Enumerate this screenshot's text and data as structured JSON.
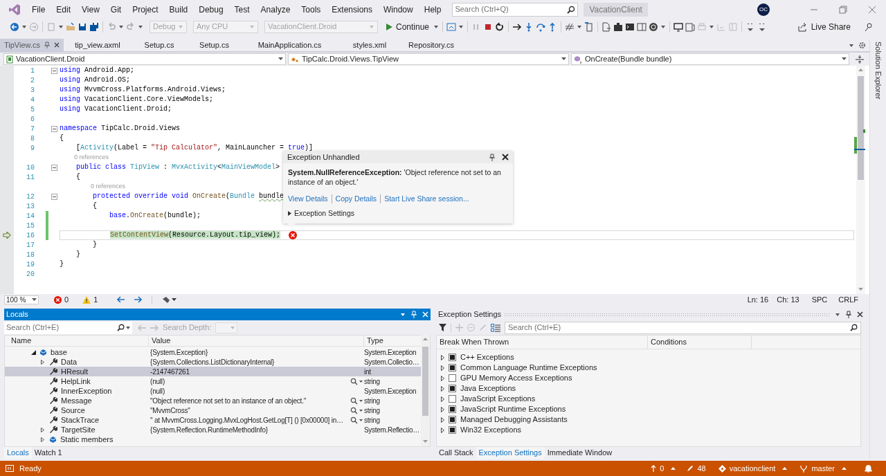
{
  "menu_bar": {
    "menus": [
      "File",
      "Edit",
      "View",
      "Git",
      "Project",
      "Build",
      "Debug",
      "Test",
      "Analyze",
      "Tools",
      "Extensions",
      "Window",
      "Help"
    ],
    "search": {
      "placeholder": "Search (Ctrl+Q)"
    },
    "solution": "VacationClient",
    "avatar": "OC"
  },
  "toolbar": {
    "configuration": {
      "value": "Debug",
      "disabled": true
    },
    "platform": {
      "value": "Any CPU",
      "disabled": true
    },
    "startup_project": {
      "value": "VacationClient.Droid",
      "disabled": true
    },
    "continue": "Continue",
    "live_share": "Live Share"
  },
  "doc_tabs": [
    {
      "label": "TipView.cs",
      "selected": true
    },
    {
      "label": "tip_view.axml",
      "selected": false
    },
    {
      "label": "Setup.cs",
      "selected": false
    },
    {
      "label": "Setup.cs",
      "selected": false
    },
    {
      "label": "MainApplication.cs",
      "selected": false
    },
    {
      "label": "styles.xml",
      "selected": false
    },
    {
      "label": "Repository.cs",
      "selected": false
    }
  ],
  "nav_bar": {
    "project": "VacationClient.Droid",
    "type": "TipCalc.Droid.Views.TipView",
    "member": "OnCreate(Bundle bundle)"
  },
  "editor": {
    "lines": [
      {
        "kind": "code",
        "number": "1",
        "foldable": true,
        "changed": false,
        "current": false,
        "tokens": [
          {
            "kind": "keyword",
            "text": "using"
          },
          {
            "kind": "plain",
            "text": " Android.App;"
          }
        ]
      },
      {
        "kind": "code",
        "number": "2",
        "foldable": false,
        "changed": false,
        "current": false,
        "tokens": [
          {
            "kind": "keyword",
            "text": "using"
          },
          {
            "kind": "plain",
            "text": " Android.OS;"
          }
        ]
      },
      {
        "kind": "code",
        "number": "3",
        "foldable": false,
        "changed": false,
        "current": false,
        "tokens": [
          {
            "kind": "keyword",
            "text": "using"
          },
          {
            "kind": "plain",
            "text": " MvvmCross.Platforms.Android.Views;"
          }
        ]
      },
      {
        "kind": "code",
        "number": "4",
        "foldable": false,
        "changed": false,
        "current": false,
        "tokens": [
          {
            "kind": "keyword",
            "text": "using"
          },
          {
            "kind": "plain",
            "text": " VacationClient.Core.ViewModels;"
          }
        ]
      },
      {
        "kind": "code",
        "number": "5",
        "foldable": false,
        "changed": false,
        "current": false,
        "tokens": [
          {
            "kind": "keyword",
            "text": "using"
          },
          {
            "kind": "plain",
            "text": " VacationClient.Droid;"
          }
        ]
      },
      {
        "kind": "code",
        "number": "6",
        "foldable": false,
        "changed": false,
        "current": false
      },
      {
        "kind": "code",
        "number": "7",
        "foldable": true,
        "changed": false,
        "current": false,
        "tokens": [
          {
            "kind": "keyword",
            "text": "namespace"
          },
          {
            "kind": "plain",
            "text": " TipCalc.Droid.Views"
          }
        ]
      },
      {
        "kind": "code",
        "number": "8",
        "foldable": false,
        "changed": false,
        "current": false,
        "tokens": [
          {
            "kind": "plain",
            "text": "{"
          }
        ]
      },
      {
        "kind": "code",
        "number": "9",
        "foldable": false,
        "changed": false,
        "current": false,
        "tokens": [
          {
            "kind": "plain",
            "text": "    ["
          },
          {
            "kind": "type",
            "text": "Activity"
          },
          {
            "kind": "plain",
            "text": "(Label = "
          },
          {
            "kind": "string",
            "text": "\"Tip Calculator\""
          },
          {
            "kind": "plain",
            "text": ", MainLauncher = "
          },
          {
            "kind": "keyword",
            "text": "true"
          },
          {
            "kind": "plain",
            "text": ")]"
          }
        ]
      },
      {
        "kind": "lens",
        "text": "0 references"
      },
      {
        "kind": "code",
        "number": "10",
        "foldable": true,
        "changed": false,
        "current": false,
        "tokens": [
          {
            "kind": "keyword",
            "text": "    public class "
          },
          {
            "kind": "type",
            "text": "TipView"
          },
          {
            "kind": "plain",
            "text": " : "
          },
          {
            "kind": "type",
            "text": "MvxActivity"
          },
          {
            "kind": "plain",
            "text": "<"
          },
          {
            "kind": "type",
            "text": "MainViewModel"
          },
          {
            "kind": "plain",
            "text": ">"
          }
        ]
      },
      {
        "kind": "code",
        "number": "11",
        "foldable": false,
        "changed": false,
        "current": false,
        "tokens": [
          {
            "kind": "plain",
            "text": "    {"
          }
        ]
      },
      {
        "kind": "lens",
        "text": "0 references"
      },
      {
        "kind": "code",
        "number": "12",
        "foldable": true,
        "changed": false,
        "current": false,
        "tokens": [
          {
            "kind": "keyword",
            "text": "        protected override void "
          },
          {
            "kind": "method",
            "text": "OnCreate"
          },
          {
            "kind": "plain",
            "text": "("
          },
          {
            "kind": "type",
            "text": "Bundle "
          },
          {
            "kind": "warning",
            "text": "bundle"
          }
        ]
      },
      {
        "kind": "code",
        "number": "13",
        "foldable": false,
        "changed": false,
        "current": false,
        "tokens": [
          {
            "kind": "plain",
            "text": "        {"
          }
        ]
      },
      {
        "kind": "code",
        "number": "14",
        "foldable": false,
        "changed": true,
        "current": false,
        "tokens": [
          {
            "kind": "keyword",
            "text": "            base"
          },
          {
            "kind": "plain",
            "text": "."
          },
          {
            "kind": "method",
            "text": "OnCreate"
          },
          {
            "kind": "plain",
            "text": "(bundle);"
          }
        ]
      },
      {
        "kind": "code",
        "number": "15",
        "foldable": false,
        "changed": true,
        "current": false
      },
      {
        "kind": "code",
        "number": "16",
        "foldable": false,
        "changed": true,
        "current": true,
        "tokens": [
          {
            "kind": "method",
            "text": "            SetContentView"
          },
          {
            "kind": "plain",
            "text": "(Resource.Layout.tip_view);"
          }
        ]
      },
      {
        "kind": "code",
        "number": "17",
        "foldable": false,
        "changed": false,
        "current": false,
        "tokens": [
          {
            "kind": "plain",
            "text": "        }"
          }
        ]
      },
      {
        "kind": "code",
        "number": "18",
        "foldable": false,
        "changed": false,
        "current": false,
        "tokens": [
          {
            "kind": "plain",
            "text": "    }"
          }
        ]
      },
      {
        "kind": "code",
        "number": "19",
        "foldable": false,
        "changed": false,
        "current": false,
        "tokens": [
          {
            "kind": "plain",
            "text": "}"
          }
        ]
      },
      {
        "kind": "code",
        "number": "20",
        "foldable": false,
        "changed": false,
        "current": false
      }
    ]
  },
  "exception_popup": {
    "title": "Exception Unhandled",
    "message": "**System.NullReferenceException:** 'Object reference not set to an instance of an object.'",
    "links": [
      "View Details",
      "Copy Details",
      "Start Live Share session..."
    ],
    "settings": "Exception Settings"
  },
  "editor_status": {
    "zoom": "100 %",
    "errors": "0",
    "warnings": "1",
    "line": "Ln: 16",
    "column": "Ch: 13",
    "indent": "SPC",
    "line_ending": "CRLF"
  },
  "locals": {
    "title": "Locals",
    "search": {
      "placeholder": "Search (Ctrl+E)"
    },
    "search_depth": "Search Depth:",
    "columns": [
      "Name",
      "Value",
      "Type"
    ],
    "rows": [
      {
        "name": "base",
        "value": "{System.Exception}",
        "type": "System.Exception",
        "kind": "object",
        "expandable": true,
        "expanded": true,
        "selected": false,
        "visualizer": false,
        "children": [
          {
            "name": "Data",
            "value": "{System.Collections.ListDictionaryInternal}",
            "type": "System.Collectio…",
            "kind": "property",
            "expandable": true,
            "expanded": false,
            "selected": false,
            "visualizer": false
          },
          {
            "name": "HResult",
            "value": "-2147467261",
            "type": "int",
            "kind": "property",
            "expandable": false,
            "expanded": false,
            "selected": true,
            "visualizer": false
          },
          {
            "name": "HelpLink",
            "value": "(null)",
            "type": "string",
            "kind": "property",
            "expandable": false,
            "expanded": false,
            "selected": false,
            "visualizer": true
          },
          {
            "name": "InnerException",
            "value": "(null)",
            "type": "System.Exception",
            "kind": "property",
            "expandable": false,
            "expanded": false,
            "selected": false,
            "visualizer": false
          },
          {
            "name": "Message",
            "value": "\"Object reference not set to an instance of an object.\"",
            "type": "string",
            "kind": "property",
            "expandable": false,
            "expanded": false,
            "selected": false,
            "visualizer": true
          },
          {
            "name": "Source",
            "value": "\"MvvmCross\"",
            "type": "string",
            "kind": "property",
            "expandable": false,
            "expanded": false,
            "selected": false,
            "visualizer": true
          },
          {
            "name": "StackTrace",
            "value": "\"  at MvvmCross.Logging.MvxLogHost.GetLog[T] () [0x00000] in…",
            "type": "string",
            "kind": "property",
            "expandable": false,
            "expanded": false,
            "selected": false,
            "visualizer": true
          },
          {
            "name": "TargetSite",
            "value": "{System.Reflection.RuntimeMethodInfo}",
            "type": "System.Reflectio…",
            "kind": "property",
            "expandable": true,
            "expanded": false,
            "selected": false,
            "visualizer": false
          },
          {
            "name": "Static members",
            "kind": "object",
            "expandable": true,
            "expanded": false,
            "selected": false,
            "visualizer": false
          }
        ]
      }
    ],
    "tabs": [
      {
        "label": "Locals",
        "selected": true
      },
      {
        "label": "Watch 1",
        "selected": false
      }
    ]
  },
  "exception_settings": {
    "title": "Exception Settings",
    "search": {
      "placeholder": "Search (Ctrl+E)"
    },
    "columns": [
      "Break When Thrown",
      "Conditions"
    ],
    "rows": [
      {
        "label": "C++ Exceptions",
        "checked": true
      },
      {
        "label": "Common Language Runtime Exceptions",
        "checked": true
      },
      {
        "label": "GPU Memory Access Exceptions",
        "checked": false
      },
      {
        "label": "Java Exceptions",
        "checked": true
      },
      {
        "label": "JavaScript Exceptions",
        "checked": false
      },
      {
        "label": "JavaScript Runtime Exceptions",
        "checked": true
      },
      {
        "label": "Managed Debugging Assistants",
        "checked": true
      },
      {
        "label": "Win32 Exceptions",
        "checked": true
      }
    ],
    "tabs": [
      {
        "label": "Call Stack",
        "selected": false
      },
      {
        "label": "Exception Settings",
        "selected": true
      },
      {
        "label": "Immediate Window",
        "selected": false
      }
    ]
  },
  "solution_explorer": "Solution Explorer",
  "status_bar": {
    "state": "Ready",
    "pushes": "0",
    "changes": "48",
    "repository": "vacationclient",
    "branch": "master"
  }
}
